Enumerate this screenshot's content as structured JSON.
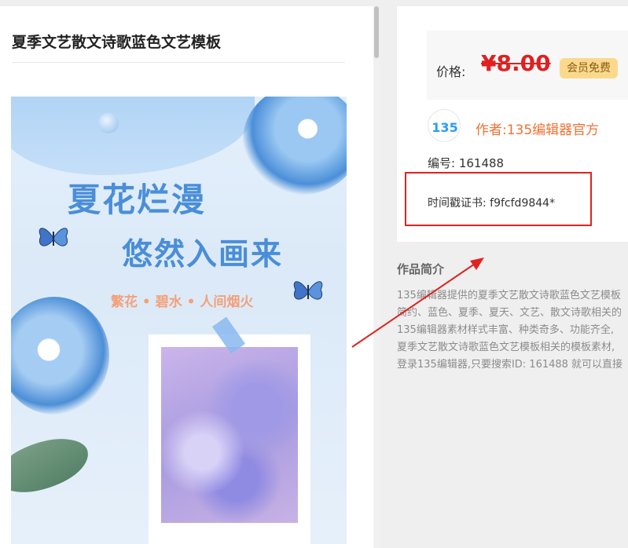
{
  "template": {
    "title": "夏季文艺散文诗歌蓝色文艺模板"
  },
  "poster": {
    "heading1": "夏花烂漫",
    "heading2": "悠然入画来",
    "subtitle": "繁花 • 碧水 • 人间烟火"
  },
  "price": {
    "label": "价格:",
    "value": "¥8.00",
    "member_badge": "会员免费"
  },
  "author": {
    "avatar_text": "135",
    "label": "作者:135编辑器官方"
  },
  "info": {
    "code": "编号: 161488",
    "timestamp": "时间戳证书: f9fcfd9844*"
  },
  "intro": {
    "title": "作品简介",
    "lines": [
      "135编辑器提供的夏季文艺散文诗歌蓝色文艺模板",
      "简约、蓝色、夏季、夏天、文艺、散文诗歌相关的",
      "135编辑器素材样式丰富、种类奇多、功能齐全,",
      "夏季文艺散文诗歌蓝色文艺模板相关的模板素材,",
      "登录135编辑器,只要搜索ID: 161488 就可以直接"
    ]
  },
  "colors": {
    "accent_red": "#e02020",
    "author_orange": "#f07132",
    "poster_blue": "#4a8ed8",
    "badge_gold": "#fbd98c"
  }
}
